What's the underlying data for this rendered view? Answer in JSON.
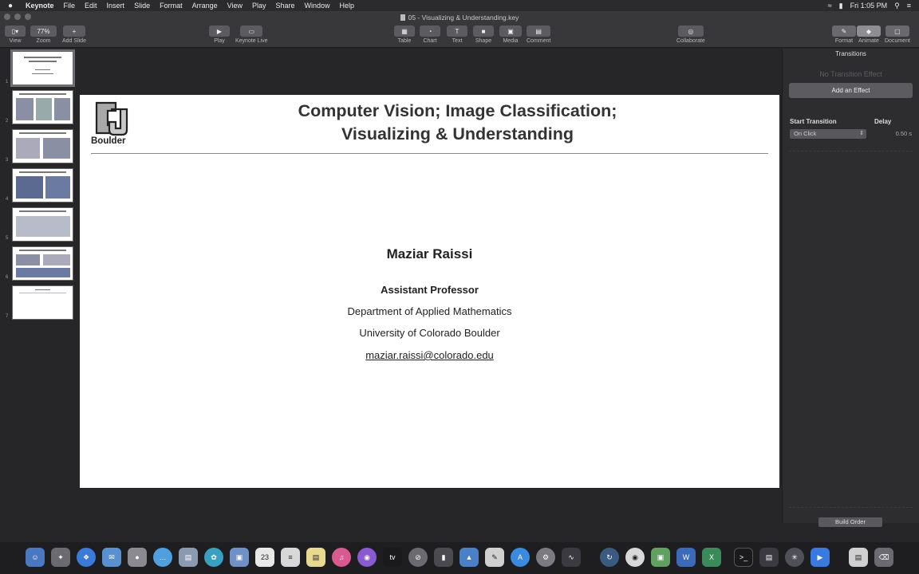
{
  "menubar": {
    "apple": "",
    "items": [
      "Keynote",
      "File",
      "Edit",
      "Insert",
      "Slide",
      "Format",
      "Arrange",
      "View",
      "Play",
      "Share",
      "Window",
      "Help"
    ],
    "clock": "Fri 1:05 PM"
  },
  "window": {
    "title": "05 - Visualizing & Understanding.key"
  },
  "toolbar": {
    "view": {
      "label": "View",
      "value": "▯▾"
    },
    "zoom": {
      "label": "Zoom",
      "value": "77%"
    },
    "add_slide": {
      "label": "Add Slide",
      "value": "+"
    },
    "play": {
      "label": "Play",
      "value": "▶"
    },
    "keynote_live": {
      "label": "Keynote Live",
      "value": "▭"
    },
    "table": {
      "label": "Table",
      "value": "▦"
    },
    "chart": {
      "label": "Chart",
      "value": "◔"
    },
    "text": {
      "label": "Text",
      "value": "T"
    },
    "shape": {
      "label": "Shape",
      "value": "■"
    },
    "media": {
      "label": "Media",
      "value": "▣"
    },
    "comment": {
      "label": "Comment",
      "value": "▤"
    },
    "collaborate": {
      "label": "Collaborate",
      "value": "◎"
    },
    "format": {
      "label": "Format",
      "value": "✎"
    },
    "animate": {
      "label": "Animate",
      "value": "◆"
    },
    "document": {
      "label": "Document",
      "value": "▢"
    }
  },
  "navigator": {
    "slides": [
      "1",
      "2",
      "3",
      "4",
      "5",
      "6",
      "7"
    ]
  },
  "slide": {
    "title_line1": "Computer Vision; Image Classification;",
    "title_line2": "Visualizing & Understanding",
    "logo_text": "Boulder",
    "author": "Maziar Raissi",
    "position": "Assistant Professor",
    "department": "Department of Applied Mathematics",
    "university": "University of Colorado Boulder",
    "email": "maziar.raissi@colorado.edu"
  },
  "inspector": {
    "tab": "Transitions",
    "no_effect": "No Transition Effect",
    "add_effect": "Add an Effect",
    "start_transition_label": "Start Transition",
    "delay_label": "Delay",
    "start_transition_value": "On Click",
    "delay_value": "0.50 s",
    "build_order": "Build Order"
  },
  "colors": {
    "background": "#262628",
    "toolbar": "#38383a",
    "slide": "#ffffff",
    "button": "#5c5c60"
  }
}
